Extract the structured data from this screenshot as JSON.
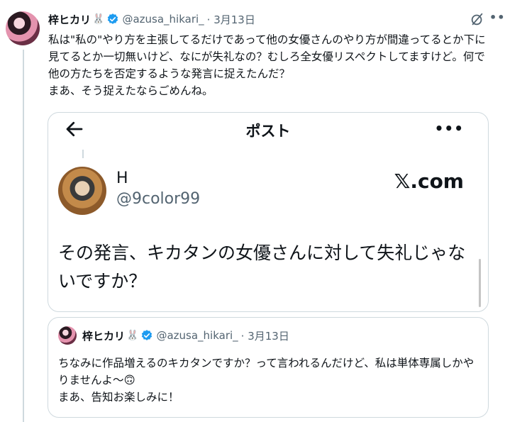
{
  "tweet": {
    "author_name": "梓ヒカリ",
    "name_emoji": "🐰",
    "handle": "@azusa_hikari_",
    "date": "· 3月13日",
    "more_label": "•••",
    "text": "私は\"私の\"やり方を主張してるだけであって他の女優さんのやり方が間違ってるとか下に見てるとか一切無いけど、なにが失礼なの？むしろ全女優リスペクトしてますけど。何で他の方たちを否定するような発言に捉えたんだ？\nまあ、そう捉えたならごめんね。"
  },
  "embed": {
    "title": "ポスト",
    "more_label": "•••",
    "author_name": "H",
    "handle": "@9color99",
    "site_logo": "𝕏.com",
    "text": "その発言、キカタンの女優さんに対して失礼じゃないですか？"
  },
  "quote": {
    "author_name": "梓ヒカリ",
    "name_emoji": "🐰",
    "handle": "@azusa_hikari_",
    "date": "· 3月13日",
    "text": "ちなみに作品増えるのキカタンですか？って言われるんだけど、私は単体専属しかやりませんよ〜🙃\nまあ、告知お楽しみに！"
  },
  "colors": {
    "verified": "#1d9bf0",
    "secondary_text": "#536471",
    "border": "#cfd9de"
  },
  "icons": [
    "verified-badge-icon",
    "grok-icon",
    "more-icon",
    "back-arrow-icon"
  ]
}
